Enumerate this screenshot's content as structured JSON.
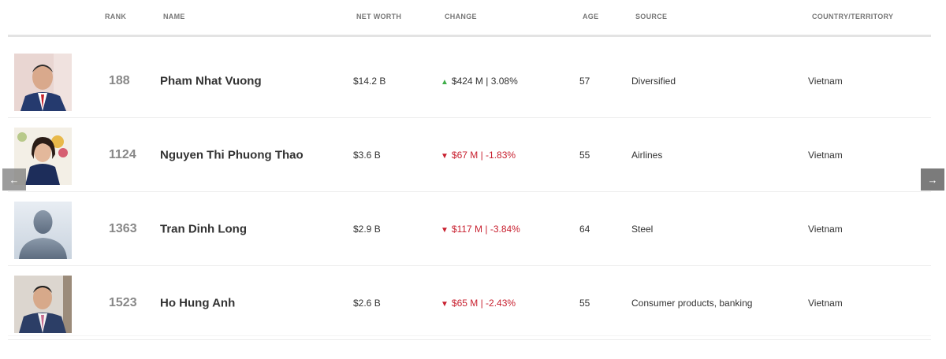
{
  "columns": {
    "rank": "RANK",
    "name": "NAME",
    "net_worth": "NET WORTH",
    "change": "CHANGE",
    "age": "AGE",
    "source": "SOURCE",
    "country": "COUNTRY/TERRITORY"
  },
  "colors": {
    "up": "#3fae49",
    "down": "#c8202f",
    "rank": "#888888"
  },
  "rows": [
    {
      "rank": "188",
      "name": "Pham Nhat Vuong",
      "net_worth": "$14.2 B",
      "change_direction": "up",
      "change_arrow": "▲",
      "change": "$424 M | 3.08%",
      "age": "57",
      "source": "Diversified",
      "country": "Vietnam",
      "avatar": "photo-man-suit-red-tie"
    },
    {
      "rank": "1124",
      "name": "Nguyen Thi Phuong Thao",
      "net_worth": "$3.6 B",
      "change_direction": "down",
      "change_arrow": "▼",
      "change": "$67 M | -1.83%",
      "age": "55",
      "source": "Airlines",
      "country": "Vietnam",
      "avatar": "photo-woman-flowers"
    },
    {
      "rank": "1363",
      "name": "Tran Dinh Long",
      "net_worth": "$2.9 B",
      "change_direction": "down",
      "change_arrow": "▼",
      "change": "$117 M | -3.84%",
      "age": "64",
      "source": "Steel",
      "country": "Vietnam",
      "avatar": "placeholder-silhouette"
    },
    {
      "rank": "1523",
      "name": "Ho Hung Anh",
      "net_worth": "$2.6 B",
      "change_direction": "down",
      "change_arrow": "▼",
      "change": "$65 M | -2.43%",
      "age": "55",
      "source": "Consumer products, banking",
      "country": "Vietnam",
      "avatar": "photo-man-suit-pink-tie"
    }
  ],
  "nav": {
    "prev_icon": "←",
    "next_icon": "→"
  }
}
